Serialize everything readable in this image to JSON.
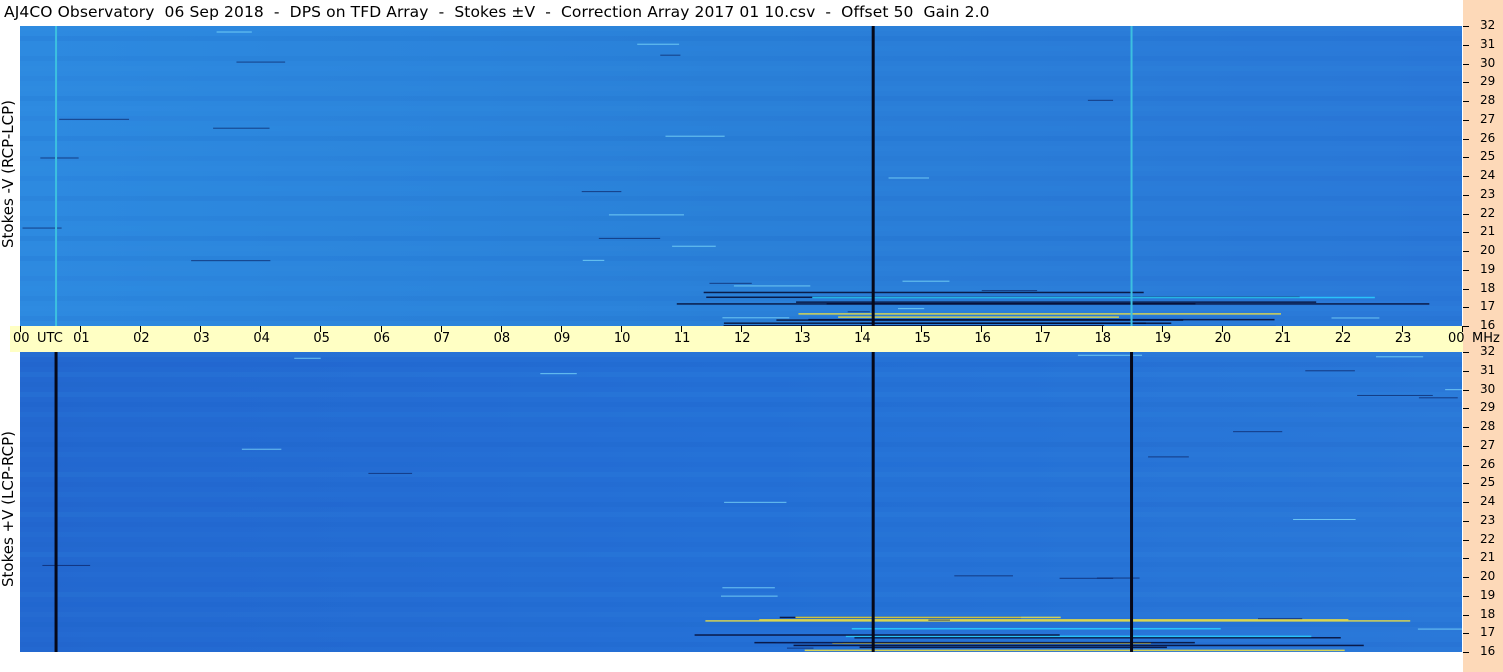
{
  "title": "AJ4CO Observatory  06 Sep 2018  -  DPS on TFD Array  -  Stokes ±V  -  Correction Array 2017 01 10.csv  -  Offset 50  Gain 2.0",
  "panels": {
    "top": {
      "label": "Stokes -V (RCP-LCP)"
    },
    "bottom": {
      "label": "Stokes +V (LCP-RCP)"
    }
  },
  "chart_data": {
    "type": "heatmap",
    "title": "AJ4CO Observatory  06 Sep 2018  -  DPS on TFD Array  -  Stokes ±V  -  Correction Array 2017 01 10.csv  -  Offset 50  Gain 2.0",
    "x_axis": {
      "unit_label": "UTC",
      "ticks": [
        "00",
        "01",
        "02",
        "03",
        "04",
        "05",
        "06",
        "07",
        "08",
        "09",
        "10",
        "11",
        "12",
        "13",
        "14",
        "15",
        "16",
        "17",
        "18",
        "19",
        "20",
        "21",
        "22",
        "23",
        "00"
      ],
      "range_hours": [
        0,
        24
      ]
    },
    "y_axis": {
      "unit_label": "MHz",
      "ticks": [
        "32",
        "31",
        "30",
        "29",
        "28",
        "27",
        "26",
        "25",
        "24",
        "23",
        "22",
        "21",
        "20",
        "19",
        "18",
        "17",
        "16"
      ],
      "range_mhz": [
        16,
        32
      ]
    },
    "colors": {
      "background": "#2a7fd6",
      "strong": "#050a30",
      "accent": "#2ad0ff",
      "axis_band": "#ffffc4",
      "right_strip": "#fdd9b8"
    },
    "features": [
      {
        "type": "vertical_line",
        "utc_hour": 0.6,
        "panel": "top",
        "color": "#3cc0e0"
      },
      {
        "type": "vertical_line",
        "utc_hour": 0.6,
        "panel": "bottom",
        "color": "#060818"
      },
      {
        "type": "vertical_line",
        "utc_hour": 14.2,
        "panel": "top",
        "color": "#060818"
      },
      {
        "type": "vertical_line",
        "utc_hour": 14.2,
        "panel": "bottom",
        "color": "#060818"
      },
      {
        "type": "vertical_line",
        "utc_hour": 18.5,
        "panel": "top",
        "color": "#3cc0e0"
      },
      {
        "type": "vertical_line",
        "utc_hour": 18.5,
        "panel": "bottom",
        "color": "#060818"
      },
      {
        "type": "interference_band",
        "utc_start": 10.8,
        "utc_end": 24,
        "mhz_low": 16,
        "mhz_high": 18
      }
    ]
  }
}
